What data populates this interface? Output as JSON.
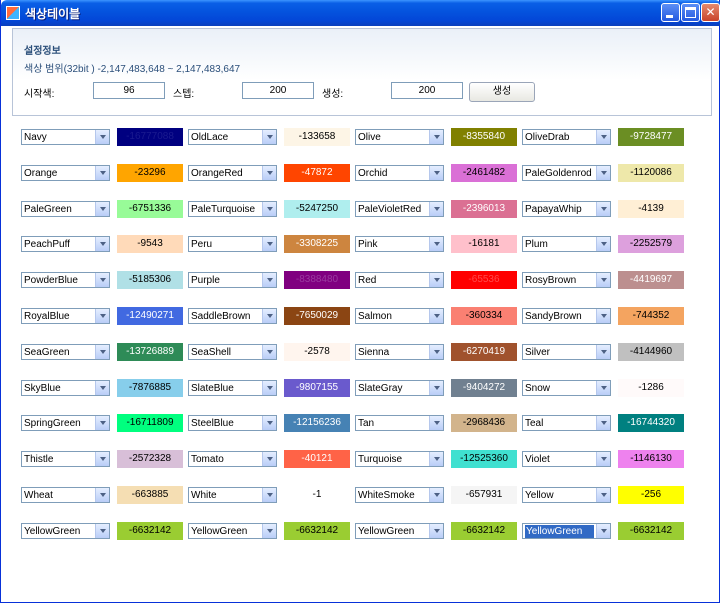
{
  "window": {
    "title": "색상테이블",
    "title_bar_color": "#0453de"
  },
  "settings": {
    "heading": "설정정보",
    "range_text": "색상 범위(32bit )  -2,147,483,648 ~ 2,147,483,647",
    "start_label": "시작색:",
    "start_value": "96",
    "step_label": "스텝:",
    "step_value": "200",
    "gen_label": "생성:",
    "gen_value": "200",
    "generate_button": "생성"
  },
  "cells": [
    [
      {
        "name": "Navy",
        "value": "-16777088",
        "color": "#000080",
        "text": "#1a1a8f"
      },
      {
        "name": "OldLace",
        "value": "-133658",
        "color": "#fdf5e6",
        "text": "#000000"
      },
      {
        "name": "Olive",
        "value": "-8355840",
        "color": "#808000",
        "text": "#ffffff"
      },
      {
        "name": "OliveDrab",
        "value": "-9728477",
        "color": "#6b8e23",
        "text": "#ffffff"
      }
    ],
    [
      {
        "name": "Orange",
        "value": "-23296",
        "color": "#ffa500",
        "text": "#000000"
      },
      {
        "name": "OrangeRed",
        "value": "-47872",
        "color": "#ff4500",
        "text": "#ffffff"
      },
      {
        "name": "Orchid",
        "value": "-2461482",
        "color": "#da70d6",
        "text": "#000000"
      },
      {
        "name": "PaleGoldenrod",
        "value": "-1120086",
        "color": "#eee8aa",
        "text": "#000000"
      }
    ],
    [
      {
        "name": "PaleGreen",
        "value": "-6751336",
        "color": "#98fb98",
        "text": "#000000"
      },
      {
        "name": "PaleTurquoise",
        "value": "-5247250",
        "color": "#afeeee",
        "text": "#000000"
      },
      {
        "name": "PaleVioletRed",
        "value": "-2396013",
        "color": "#db7093",
        "text": "#ffffff"
      },
      {
        "name": "PapayaWhip",
        "value": "-4139",
        "color": "#ffefd5",
        "text": "#000000"
      }
    ],
    [
      {
        "name": "PeachPuff",
        "value": "-9543",
        "color": "#ffdab9",
        "text": "#000000"
      },
      {
        "name": "Peru",
        "value": "-3308225",
        "color": "#cd853f",
        "text": "#ffffff"
      },
      {
        "name": "Pink",
        "value": "-16181",
        "color": "#ffc0cb",
        "text": "#000000"
      },
      {
        "name": "Plum",
        "value": "-2252579",
        "color": "#dda0dd",
        "text": "#000000"
      }
    ],
    [
      {
        "name": "PowderBlue",
        "value": "-5185306",
        "color": "#b0e0e6",
        "text": "#000000"
      },
      {
        "name": "Purple",
        "value": "-8388480",
        "color": "#800080",
        "text": "#9a3aa0"
      },
      {
        "name": "Red",
        "value": "-65536",
        "color": "#ff0000",
        "text": "#ff4a4a"
      },
      {
        "name": "RosyBrown",
        "value": "-4419697",
        "color": "#bc8f8f",
        "text": "#ffffff"
      }
    ],
    [
      {
        "name": "RoyalBlue",
        "value": "-12490271",
        "color": "#4169e1",
        "text": "#ffffff"
      },
      {
        "name": "SaddleBrown",
        "value": "-7650029",
        "color": "#8b4513",
        "text": "#ffffff"
      },
      {
        "name": "Salmon",
        "value": "-360334",
        "color": "#fa8072",
        "text": "#000000"
      },
      {
        "name": "SandyBrown",
        "value": "-744352",
        "color": "#f4a460",
        "text": "#000000"
      }
    ],
    [
      {
        "name": "SeaGreen",
        "value": "-13726889",
        "color": "#2e8b57",
        "text": "#ffffff"
      },
      {
        "name": "SeaShell",
        "value": "-2578",
        "color": "#fff5ee",
        "text": "#000000"
      },
      {
        "name": "Sienna",
        "value": "-6270419",
        "color": "#a0522d",
        "text": "#ffffff"
      },
      {
        "name": "Silver",
        "value": "-4144960",
        "color": "#c0c0c0",
        "text": "#000000"
      }
    ],
    [
      {
        "name": "SkyBlue",
        "value": "-7876885",
        "color": "#87ceeb",
        "text": "#000000"
      },
      {
        "name": "SlateBlue",
        "value": "-9807155",
        "color": "#6a5acd",
        "text": "#ffffff"
      },
      {
        "name": "SlateGray",
        "value": "-9404272",
        "color": "#708090",
        "text": "#ffffff"
      },
      {
        "name": "Snow",
        "value": "-1286",
        "color": "#fffafa",
        "text": "#000000"
      }
    ],
    [
      {
        "name": "SpringGreen",
        "value": "-16711809",
        "color": "#00ff7f",
        "text": "#000000"
      },
      {
        "name": "SteelBlue",
        "value": "-12156236",
        "color": "#4682b4",
        "text": "#ffffff"
      },
      {
        "name": "Tan",
        "value": "-2968436",
        "color": "#d2b48c",
        "text": "#000000"
      },
      {
        "name": "Teal",
        "value": "-16744320",
        "color": "#008080",
        "text": "#ffffff"
      }
    ],
    [
      {
        "name": "Thistle",
        "value": "-2572328",
        "color": "#d8bfd8",
        "text": "#000000"
      },
      {
        "name": "Tomato",
        "value": "-40121",
        "color": "#ff6347",
        "text": "#ffffff"
      },
      {
        "name": "Turquoise",
        "value": "-12525360",
        "color": "#40e0d0",
        "text": "#000000"
      },
      {
        "name": "Violet",
        "value": "-1146130",
        "color": "#ee82ee",
        "text": "#000000"
      }
    ],
    [
      {
        "name": "Wheat",
        "value": "-663885",
        "color": "#f5deb3",
        "text": "#000000"
      },
      {
        "name": "White",
        "value": "-1",
        "color": "#ffffff",
        "text": "#000000"
      },
      {
        "name": "WhiteSmoke",
        "value": "-657931",
        "color": "#f5f5f5",
        "text": "#000000"
      },
      {
        "name": "Yellow",
        "value": "-256",
        "color": "#ffff00",
        "text": "#000000"
      }
    ],
    [
      {
        "name": "YellowGreen",
        "value": "-6632142",
        "color": "#9acd32",
        "text": "#000000"
      },
      {
        "name": "YellowGreen",
        "value": "-6632142",
        "color": "#9acd32",
        "text": "#000000"
      },
      {
        "name": "YellowGreen",
        "value": "-6632142",
        "color": "#9acd32",
        "text": "#000000"
      },
      {
        "name": "YellowGreen",
        "value": "-6632142",
        "color": "#9acd32",
        "text": "#000000",
        "selected": true
      }
    ]
  ]
}
